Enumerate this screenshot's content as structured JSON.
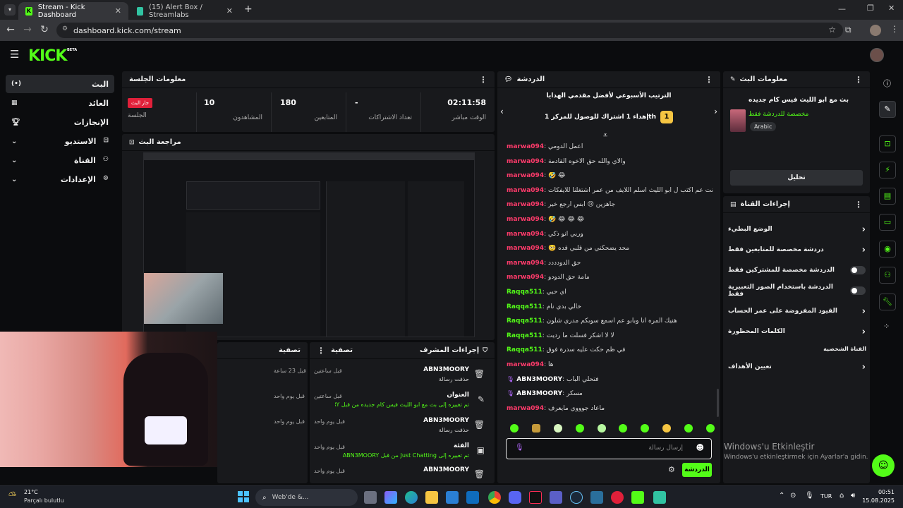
{
  "browser": {
    "tabs": [
      {
        "label": "Stream - Kick Dashboard",
        "active": true
      },
      {
        "label": "(15) Alert Box / Streamlabs",
        "active": false
      }
    ],
    "url": "dashboard.kick.com/stream"
  },
  "brand": {
    "logo": "KICK",
    "beta": "BETA",
    "accent": "#53fc18"
  },
  "sidebar": {
    "items": [
      {
        "label": "البث"
      },
      {
        "label": "العائد"
      },
      {
        "label": "الإنجازات"
      },
      {
        "label": "الاستديو"
      },
      {
        "label": "القناة"
      },
      {
        "label": "الإعدادات"
      }
    ]
  },
  "session": {
    "title": "معلومات الجلسة",
    "stats": [
      {
        "value": "02:11:58",
        "label": "الوقت مباشر"
      },
      {
        "value": "-",
        "label": "تعداد الاشتراكات"
      },
      {
        "value": "180",
        "label": "المتابعين"
      },
      {
        "value": "10",
        "label": "المشاهدون"
      }
    ],
    "live_badge": "جار البث",
    "live_label": "الجلسة"
  },
  "preview": {
    "title": "مراجعة البث"
  },
  "mod_actions": {
    "title": "إجراءات المشرف",
    "filter_label": "تصفية",
    "items": [
      {
        "user": "ABN3MOORY",
        "text": "حذفت رسالة",
        "time": "قبل ساعتين"
      },
      {
        "user": "العنوان",
        "text": "تم تغييره إلى بث مع ابو الليث فيس كام جديده من قبل ABN3MOORY",
        "time": "قبل ساعتين"
      },
      {
        "user": "ABN3MOORY",
        "text": "حذفت رسالة",
        "time": "قبل يوم واحد"
      },
      {
        "user": "الفئة",
        "text": "تم تغييره إلى Just Chatting من قبل ABN3MOORY",
        "time": "قبل يوم واحد"
      },
      {
        "user": "ABN3MOORY",
        "text": "",
        "time": "قبل يوم واحد"
      }
    ]
  },
  "left_filter": {
    "title": "تصفية",
    "times": [
      "قبل 23 ساعة",
      "قبل يوم واحد",
      "قبل يوم واحد"
    ]
  },
  "chat": {
    "title": "الدردشة",
    "leaderboard_title": "الترتيب الأسبوعي لأفضل مقدمي الهدايا",
    "leaderboard_sub": "إهداء 1 اشتراك للوصول للمركز 1th",
    "leaderboard_rank": "1",
    "messages": [
      {
        "user": "marwa094",
        "text": "اعمل الدومي",
        "color": "#ff3b6b"
      },
      {
        "user": "marwa094",
        "text": "والاي والله حق الاخوه القادمة",
        "color": "#ff3b6b"
      },
      {
        "user": "marwa094",
        "text": "🤣 😂",
        "color": "#ff3b6b"
      },
      {
        "user": "marwa094",
        "text": "كنت عم اكتب ل ابو الليث اسلم اللايف من عمر اشتغلنا للايفكات",
        "color": "#ff3b6b"
      },
      {
        "user": "marwa094",
        "text": "جاهزين 😢 ابس ارجع خير",
        "color": "#ff3b6b"
      },
      {
        "user": "marwa094",
        "text": "🤣 😂 😂 😂",
        "color": "#ff3b6b"
      },
      {
        "user": "marwa094",
        "text": "وربي انو ذكي",
        "color": "#ff3b6b"
      },
      {
        "user": "marwa094",
        "text": "محد يضحكني من قلبي قده 🥺",
        "color": "#ff3b6b"
      },
      {
        "user": "marwa094",
        "text": "حق الدودددد",
        "color": "#ff3b6b"
      },
      {
        "user": "marwa094",
        "text": "مامة حق الدودو",
        "color": "#ff3b6b"
      },
      {
        "user": "Raqqa511",
        "text": "اي حبي",
        "color": "#53fc18"
      },
      {
        "user": "Raqqa511",
        "text": "خالي بدي نام",
        "color": "#53fc18"
      },
      {
        "user": "Raqqa511",
        "text": "هنيك المره انا وبابو عم اسمع سوبكم مدري شلون",
        "color": "#53fc18"
      },
      {
        "user": "Raqqa511",
        "text": "لا لا أشكر فسلت ما رديت",
        "color": "#53fc18"
      },
      {
        "user": "Raqqa511",
        "text": "في ظم حكت عليه سدرة فوق",
        "color": "#53fc18"
      },
      {
        "user": "marwa094",
        "text": "ها",
        "color": "#ff3b6b"
      },
      {
        "user": "ABN3MOORY",
        "text": "فتحلي الباب",
        "color": "#ffffff"
      },
      {
        "user": "ABN3MOORY",
        "text": "مسكر",
        "color": "#ffffff"
      },
      {
        "user": "marwa094",
        "text": "ماعاد جوووي مايعرف",
        "color": "#ff3b6b"
      }
    ],
    "input_placeholder": "إرسال رسالة",
    "send_label": "الدردشة"
  },
  "stream_info": {
    "title": "معلومات البث",
    "stream_title": "بث مع ابو الليث فيس كام جديده",
    "category": "مخصصة للدردشة فقط",
    "language": "Arabic",
    "edit_label": "تحليل"
  },
  "channel_actions": {
    "title": "إجراءات القناة",
    "rows": [
      {
        "label": "الوضع البطيء",
        "kind": "arrow"
      },
      {
        "label": "دردشة مخصصة للمتابعين فقط",
        "kind": "arrow"
      },
      {
        "label": "الدردشة مخصصة للمشتركين فقط",
        "kind": "toggle"
      },
      {
        "label": "الدردشة باستخدام الصور التعبيرية فقط",
        "kind": "toggle"
      },
      {
        "label": "القيود المفروضة على عمر الحساب",
        "kind": "arrow"
      },
      {
        "label": "الكلمات المحظورة",
        "kind": "arrow"
      }
    ],
    "section_label": "القناة الشخصية",
    "goals_label": "تعيين الأهداف"
  },
  "windows": {
    "activate_title": "Windows'u Etkinleştir",
    "activate_sub": "Windows'u etkinleştirmek için Ayarlar'a gidin.",
    "weather_temp": "21°C",
    "weather_desc": "Parçalı bulutlu",
    "search_placeholder": "Web'de &...",
    "lang": "TUR",
    "time": "00:51",
    "date": "15.08.2025"
  }
}
